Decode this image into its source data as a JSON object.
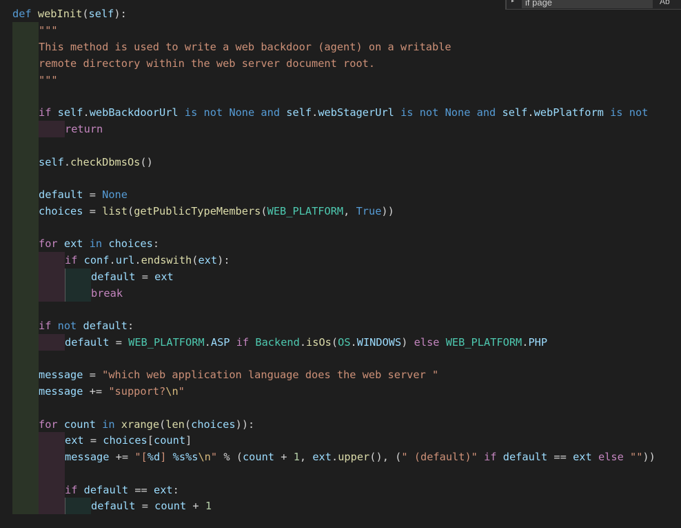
{
  "find_widget": {
    "query": "if page",
    "toggle_icon": "chevron-right-icon",
    "option_label": "Ab"
  },
  "code_lines": [
    "def webInit(self):",
    "\"\"\"",
    "This method is used to write a web backdoor (agent) on a writable",
    "remote directory within the web server document root.",
    "\"\"\"",
    "",
    "if self.webBackdoorUrl is not None and self.webStagerUrl is not None and self.webPlatform is not",
    "return",
    "",
    "self.checkDbmsOs()",
    "",
    "default = None",
    "choices = list(getPublicTypeMembers(WEB_PLATFORM, True))",
    "",
    "for ext in choices:",
    "if conf.url.endswith(ext):",
    "default = ext",
    "break",
    "",
    "if not default:",
    "default = WEB_PLATFORM.ASP if Backend.isOs(OS.WINDOWS) else WEB_PLATFORM.PHP",
    "",
    "message = \"which web application language does the web server \"",
    "message += \"support?\\n\"",
    "",
    "for count in xrange(len(choices)):",
    "ext = choices[count]",
    "message += \"[%d] %s%s\\n\" % (count + 1, ext.upper(), (\" (default)\" if default == ext else \"\"))",
    "",
    "if default == ext:",
    "default = count + 1"
  ],
  "syntax_colors": {
    "keyword": "#569cd6",
    "control": "#c586c0",
    "function": "#dcdcaa",
    "variable": "#9cdcfe",
    "class": "#4ec9b0",
    "string": "#ce9178",
    "escape": "#d7ba7d",
    "number": "#b5cea8",
    "plain": "#d4d4d4",
    "background": "#1e1e1e"
  }
}
